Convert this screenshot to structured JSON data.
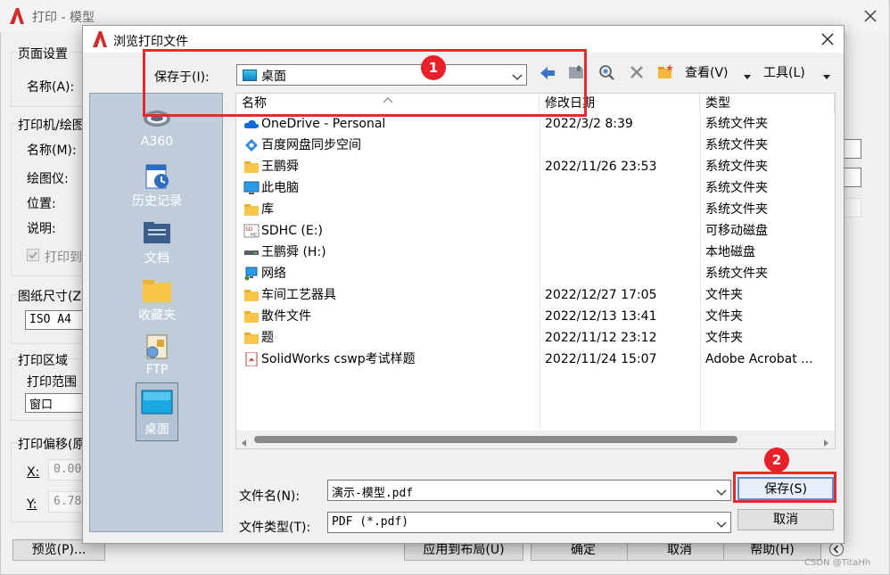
{
  "background_window": {
    "title": "打印 - 模型",
    "sections": {
      "page_setup": "页面设置",
      "name_label": "名称(A):",
      "printer_group": "打印机/绘图",
      "printer_name_label": "名称(M):",
      "plotter_label": "绘图仪:",
      "location_label": "位置:",
      "description_label": "说明:",
      "print_to_file": "打印到",
      "paper_size_group": "图纸尺寸(Z",
      "paper_size_value": "ISO A4",
      "print_area_group": "打印区域",
      "print_range_label": "打印范围",
      "print_range_value": "窗口",
      "print_offset_group": "打印偏移(原",
      "x_label": "X:",
      "x_value": "0.00",
      "y_label": "Y:",
      "y_value": "6.78"
    },
    "buttons": {
      "preview": "预览(P)...",
      "apply_to_layout": "应用到布局(U)",
      "ok": "确定",
      "cancel": "取消",
      "help": "帮助(H)"
    }
  },
  "dialog": {
    "title": "浏览打印文件",
    "save_in_label": "保存于(I):",
    "save_in_value": "桌面",
    "toolbar": {
      "view_label": "查看(V)",
      "tools_label": "工具(L)"
    },
    "places": [
      {
        "label": "A360",
        "icon": "a360-icon"
      },
      {
        "label": "历史记录",
        "icon": "history-icon"
      },
      {
        "label": "文档",
        "icon": "documents-icon"
      },
      {
        "label": "收藏夹",
        "icon": "favorites-icon"
      },
      {
        "label": "FTP",
        "icon": "ftp-icon"
      },
      {
        "label": "桌面",
        "icon": "desktop-icon"
      }
    ],
    "columns": {
      "name": "名称",
      "date": "修改日期",
      "type": "类型"
    },
    "files": [
      {
        "name": "OneDrive - Personal",
        "date": "2022/3/2 8:39",
        "type": "系统文件夹",
        "icon": "onedrive-icon"
      },
      {
        "name": "百度网盘同步空间",
        "date": "",
        "type": "系统文件夹",
        "icon": "baidu-netdisk-icon"
      },
      {
        "name": "王鹏舜",
        "date": "2022/11/26 23:53",
        "type": "系统文件夹",
        "icon": "user-folder-icon"
      },
      {
        "name": "此电脑",
        "date": "",
        "type": "系统文件夹",
        "icon": "computer-icon"
      },
      {
        "name": "库",
        "date": "",
        "type": "系统文件夹",
        "icon": "library-icon"
      },
      {
        "name": "SDHC (E:)",
        "date": "",
        "type": "可移动磁盘",
        "icon": "sd-card-icon"
      },
      {
        "name": "王鹏舜 (H:)",
        "date": "",
        "type": "本地磁盘",
        "icon": "drive-icon"
      },
      {
        "name": "网络",
        "date": "",
        "type": "系统文件夹",
        "icon": "network-icon"
      },
      {
        "name": "车间工艺器具",
        "date": "2022/12/27 17:05",
        "type": "文件夹",
        "icon": "folder-icon"
      },
      {
        "name": "散件文件",
        "date": "2022/12/13 13:41",
        "type": "文件夹",
        "icon": "folder-icon"
      },
      {
        "name": "题",
        "date": "2022/11/12 23:12",
        "type": "文件夹",
        "icon": "folder-icon"
      },
      {
        "name": "SolidWorks cswp考试样题",
        "date": "2022/11/24 15:07",
        "type": "Adobe Acrobat ...",
        "icon": "pdf-icon"
      }
    ],
    "filename_label": "文件名(N):",
    "filename_value": "演示-模型.pdf",
    "filetype_label": "文件类型(T):",
    "filetype_value": "PDF (*.pdf)",
    "save_button": "保存(S)",
    "cancel_button": "取消"
  },
  "annotations": {
    "badge_1": "1",
    "badge_2": "2"
  },
  "watermark": "CSDN @TitaHh",
  "colors": {
    "annotation_red": "#e32b2b",
    "places_bar": "#bfcddb",
    "autocad_red": "#d42a2a"
  }
}
